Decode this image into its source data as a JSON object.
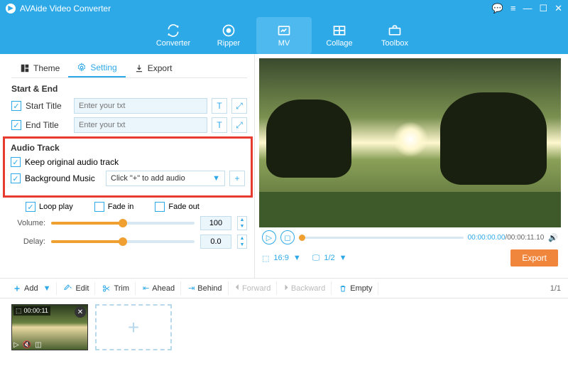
{
  "titlebar": {
    "app_name": "AVAide Video Converter"
  },
  "toolbar": {
    "converter": "Converter",
    "ripper": "Ripper",
    "mv": "MV",
    "collage": "Collage",
    "toolbox": "Toolbox"
  },
  "tabs": {
    "theme": "Theme",
    "setting": "Setting",
    "export": "Export"
  },
  "start_end": {
    "title": "Start & End",
    "start_title": "Start Title",
    "end_title": "End Title",
    "placeholder": "Enter your txt"
  },
  "audio": {
    "title": "Audio Track",
    "keep_original": "Keep original audio track",
    "bg_music": "Background Music",
    "add_audio": "Click \"+\" to add audio",
    "loop_play": "Loop play",
    "fade_in": "Fade in",
    "fade_out": "Fade out",
    "volume_lbl": "Volume:",
    "volume_val": "100",
    "delay_lbl": "Delay:",
    "delay_val": "0.0"
  },
  "player": {
    "time_current": "00:00:00.00",
    "time_total": "/00:00:11.10",
    "ratio": "16:9",
    "zoom": "1/2"
  },
  "export_btn": "Export",
  "bottombar": {
    "add": "Add",
    "edit": "Edit",
    "trim": "Trim",
    "ahead": "Ahead",
    "behind": "Behind",
    "forward": "Forward",
    "backward": "Backward",
    "empty": "Empty",
    "page": "1/1"
  },
  "clip": {
    "duration": "00:00:11"
  }
}
